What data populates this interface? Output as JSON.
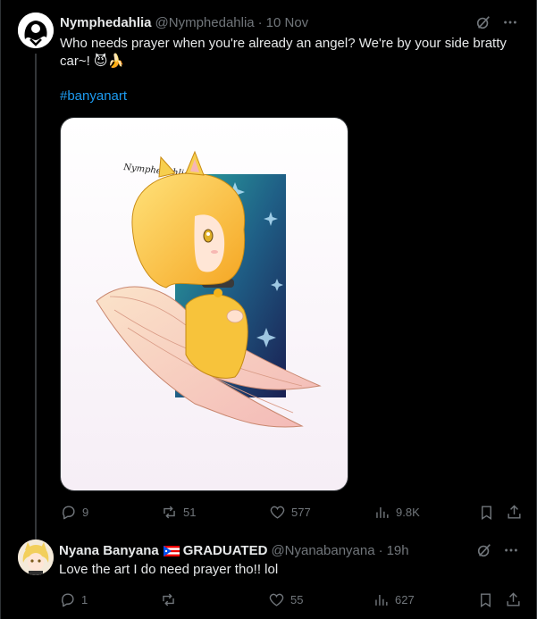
{
  "tweet1": {
    "name": "Nymphedahlia",
    "handle": "@Nymphedahlia",
    "separator": "·",
    "time": "10 Nov",
    "text_line1": "Who needs prayer when you're already an angel? We're by your side bratty",
    "text_line2": "car~! 😈🍌",
    "hashtag": "#banyanart",
    "art_signature": "Nymphedahlia",
    "replies": "9",
    "reposts": "51",
    "likes": "577",
    "views": "9.8K"
  },
  "tweet2": {
    "name": "Nyana Banyana",
    "badge": "GRADUATED",
    "handle": "@Nyanabanyana",
    "separator": "·",
    "time": "19h",
    "text": "Love the art I do need prayer tho!! lol",
    "replies": "1",
    "reposts": "",
    "likes": "55",
    "views": "627"
  },
  "icons": {
    "grok": "grok-icon",
    "more": "more-icon",
    "reply": "reply-icon",
    "repost": "repost-icon",
    "like": "heart-icon",
    "views": "views-icon",
    "bookmark": "bookmark-icon",
    "share": "share-icon"
  },
  "colors": {
    "background": "#000000",
    "text": "#e7e9ea",
    "secondary": "#71767b",
    "link": "#1d9bf0",
    "border": "#2f3336"
  }
}
